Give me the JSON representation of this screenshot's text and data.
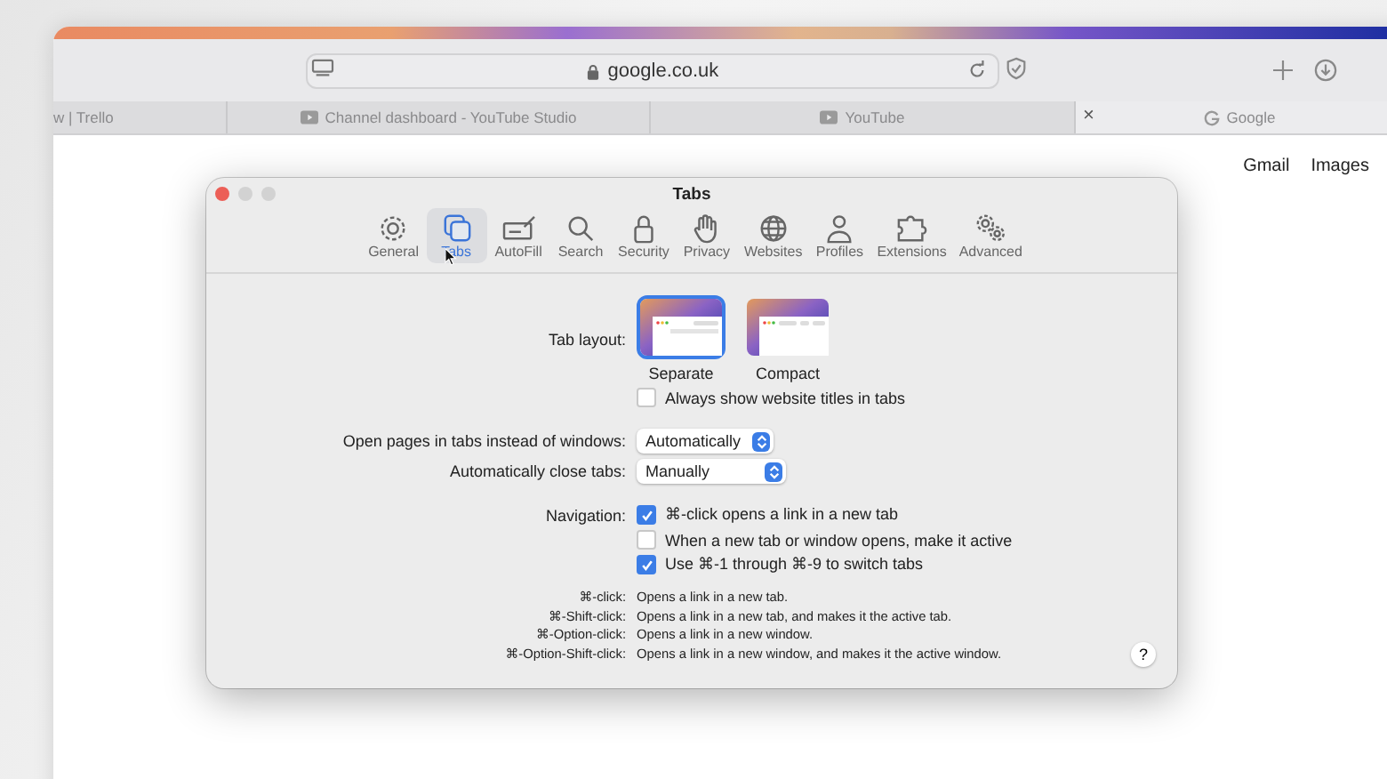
{
  "browser": {
    "address": "google.co.uk",
    "tabs": [
      {
        "title": "w | Trello",
        "selected": false
      },
      {
        "title": "Channel dashboard - YouTube Studio",
        "selected": false
      },
      {
        "title": "YouTube",
        "selected": false
      },
      {
        "title": "Google",
        "selected": true,
        "close": "×"
      }
    ],
    "page_links": [
      "Gmail",
      "Images"
    ]
  },
  "dialog": {
    "title": "Tabs",
    "toolbar": [
      {
        "label": "General",
        "selected": false
      },
      {
        "label": "Tabs",
        "selected": true
      },
      {
        "label": "AutoFill",
        "selected": false
      },
      {
        "label": "Search",
        "selected": false
      },
      {
        "label": "Security",
        "selected": false
      },
      {
        "label": "Privacy",
        "selected": false
      },
      {
        "label": "Websites",
        "selected": false
      },
      {
        "label": "Profiles",
        "selected": false
      },
      {
        "label": "Extensions",
        "selected": false
      },
      {
        "label": "Advanced",
        "selected": false
      }
    ],
    "tab_layout": {
      "label": "Tab layout:",
      "options": [
        {
          "label": "Separate",
          "kind": "separate",
          "selected": true
        },
        {
          "label": "Compact",
          "kind": "compact",
          "selected": false
        }
      ],
      "always_show_titles": {
        "label": "Always show website titles in tabs",
        "checked": false
      }
    },
    "open_pages": {
      "label": "Open pages in tabs instead of windows:",
      "value": "Automatically"
    },
    "auto_close": {
      "label": "Automatically close tabs:",
      "value": "Manually"
    },
    "navigation": {
      "label": "Navigation:",
      "options": [
        {
          "label": "⌘-click opens a link in a new tab",
          "checked": true
        },
        {
          "label": "When a new tab or window opens, make it active",
          "checked": false
        },
        {
          "label": "Use ⌘-1 through ⌘-9 to switch tabs",
          "checked": true
        }
      ]
    },
    "shortcuts": [
      {
        "keys": "⌘-click:",
        "description": "Opens a link in a new tab."
      },
      {
        "keys": "⌘-Shift-click:",
        "description": "Opens a link in a new tab, and makes it the active tab."
      },
      {
        "keys": "⌘-Option-click:",
        "description": "Opens a link in a new window."
      },
      {
        "keys": "⌘-Option-Shift-click:",
        "description": "Opens a link in a new window, and makes it the active window."
      }
    ],
    "help": "?"
  }
}
